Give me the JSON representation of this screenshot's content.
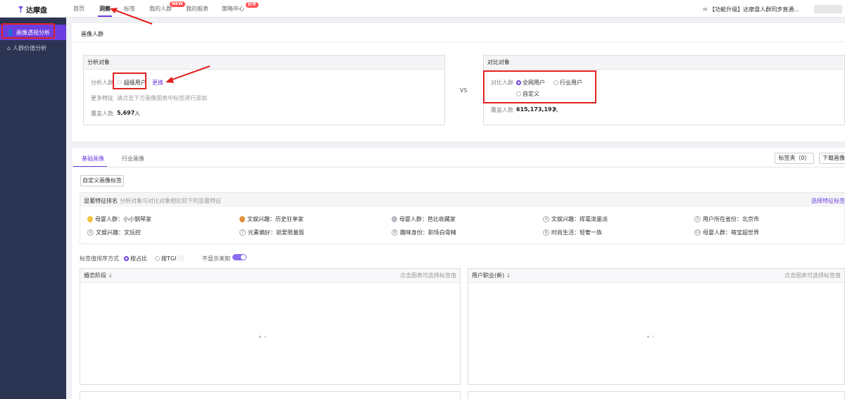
{
  "topbar": {
    "logo": "达摩盘",
    "nav": [
      "首页",
      "洞察",
      "标签",
      "我的人群",
      "我的报表",
      "策略中心"
    ],
    "badges": {
      "new": "NEW",
      "hot": "好评"
    },
    "notice": "【功能升级】达摩盘人群同步直通..."
  },
  "sidebar": {
    "items": [
      "画像透视分析",
      "人群价值分析"
    ]
  },
  "section": {
    "title": "画像人群"
  },
  "analysis": {
    "header": "分析对象",
    "crowd_label": "分析人群",
    "crowd_value": "超级用户",
    "change_link": "更换",
    "more_label": "更多特征",
    "more_hint": "请点击下方画像图表中标签进行添加",
    "cover_label": "覆盖人数",
    "cover_value": "5,697",
    "cover_unit": "人"
  },
  "vs": "VS",
  "compare": {
    "header": "对比对象",
    "crowd_label": "对比人群",
    "options": [
      "全网用户",
      "行业用户",
      "自定义"
    ],
    "cover_label": "覆盖人数",
    "cover_value": "615,173,193",
    "cover_unit": "人"
  },
  "tabs": [
    "基础画像",
    "行业画像"
  ],
  "buttons": {
    "tag_folder": "标签夹（0）",
    "download": "下载画像",
    "custom_tag": "自定义画像标签"
  },
  "features": {
    "title": "显著特征排名",
    "subtitle": "分析对象与对比对象相比较下的显著特征",
    "select_link": "选择特征标签",
    "items": [
      {
        "rank": "1",
        "text": "母婴人群：小小钢琴家"
      },
      {
        "rank": "2",
        "text": "文娱兴趣：历史狂享家"
      },
      {
        "rank": "3",
        "text": "母婴人群：芭比收藏家"
      },
      {
        "rank": "4",
        "text": "文娱兴趣：挥毫泼墨派"
      },
      {
        "rank": "5",
        "text": "用户所在省份：北京市"
      },
      {
        "rank": "6",
        "text": "文娱兴趣：文玩控"
      },
      {
        "rank": "7",
        "text": "元素偏好：就爱限量版"
      },
      {
        "rank": "8",
        "text": "趣味身份：职场白骨精"
      },
      {
        "rank": "9",
        "text": "时尚生活：轻奢一族"
      },
      {
        "rank": "10",
        "text": "母婴人群：萌宝超世界"
      }
    ]
  },
  "sort": {
    "label": "标签值排序方式",
    "opt1": "按占比",
    "opt2": "按TGI",
    "hide_unknown": "不显示未知"
  },
  "panels": [
    {
      "title": "婚恋阶段",
      "hint": "点击图表可选择标签值"
    },
    {
      "title": "用户职业(新)",
      "hint": "点击图表可选择标签值"
    }
  ],
  "colors": {
    "accent": "#6c3ee0",
    "sidebar": "#2b3553",
    "annotation": "#e0211e"
  }
}
